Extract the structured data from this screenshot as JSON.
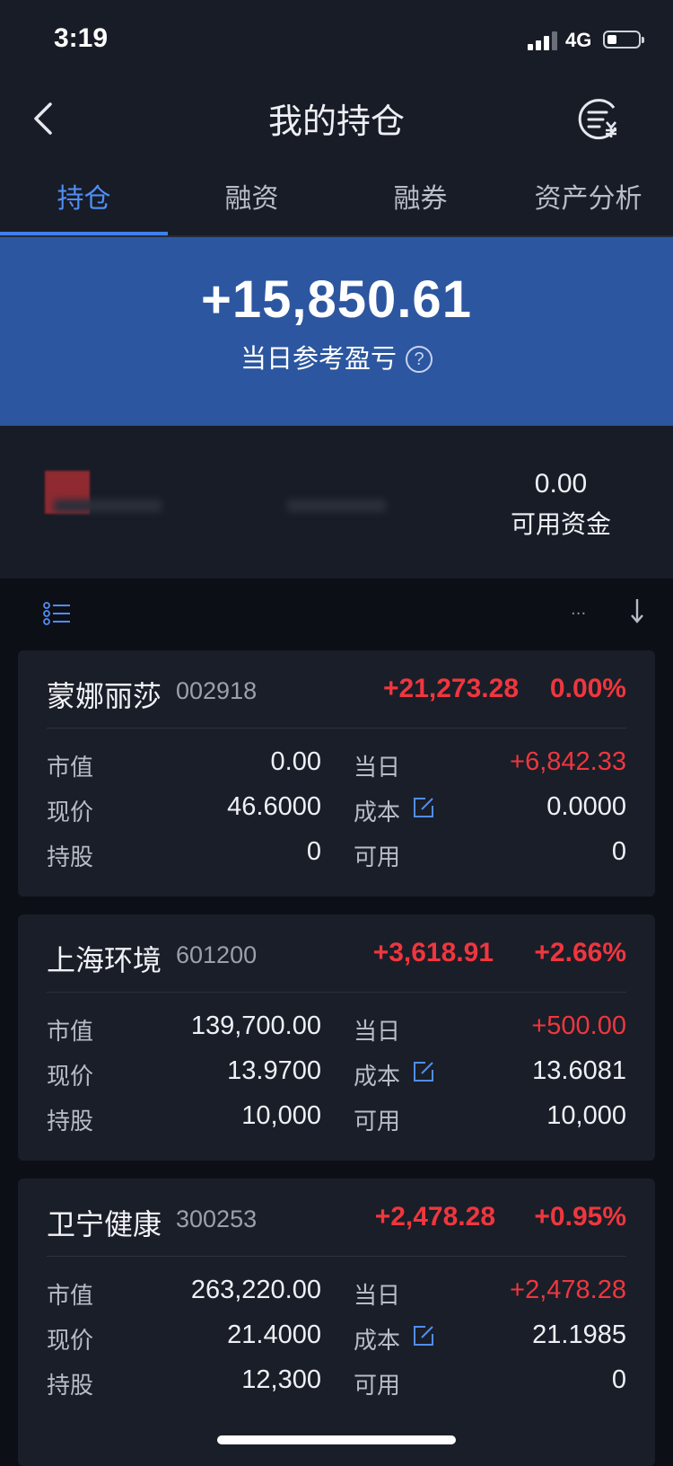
{
  "status_bar": {
    "time": "3:19",
    "network": "4G"
  },
  "header": {
    "title": "我的持仓"
  },
  "tabs": [
    {
      "label": "持仓",
      "active": true
    },
    {
      "label": "融资",
      "active": false
    },
    {
      "label": "融券",
      "active": false
    },
    {
      "label": "资产分析",
      "active": false
    }
  ],
  "summary": {
    "daily_pnl": "+15,850.61",
    "daily_pnl_label": "当日参考盈亏",
    "help_symbol": "?",
    "available_cash": "0.00",
    "available_cash_label": "可用资金"
  },
  "list_header": {
    "ellipsis": "..."
  },
  "labels": {
    "market_value": "市值",
    "price": "现价",
    "shares": "持股",
    "daily": "当日",
    "cost": "成本",
    "available": "可用"
  },
  "holdings": [
    {
      "name": "蒙娜丽莎",
      "code": "002918",
      "pnl": "+21,273.28",
      "pnl_pct": "0.00%",
      "market_value": "0.00",
      "price": "46.6000",
      "shares": "0",
      "daily": "+6,842.33",
      "cost": "0.0000",
      "available": "0"
    },
    {
      "name": "上海环境",
      "code": "601200",
      "pnl": "+3,618.91",
      "pnl_pct": "+2.66%",
      "market_value": "139,700.00",
      "price": "13.9700",
      "shares": "10,000",
      "daily": "+500.00",
      "cost": "13.6081",
      "available": "10,000"
    },
    {
      "name": "卫宁健康",
      "code": "300253",
      "pnl": "+2,478.28",
      "pnl_pct": "+0.95%",
      "market_value": "263,220.00",
      "price": "21.4000",
      "shares": "12,300",
      "daily": "+2,478.28",
      "cost": "21.1985",
      "available": "0"
    }
  ],
  "colors": {
    "accent_blue": "#3f80ee",
    "banner_blue": "#2c56a0",
    "profit_red": "#f0363e",
    "background": "#0d0f16",
    "card": "#1a1e28"
  }
}
